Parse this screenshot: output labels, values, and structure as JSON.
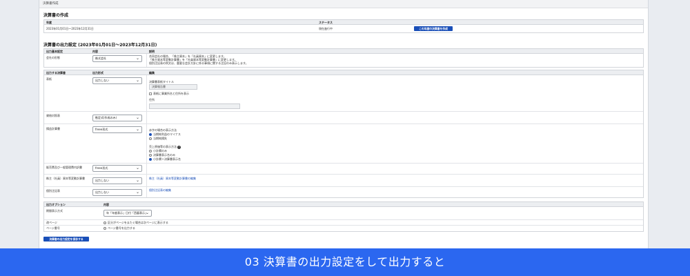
{
  "page_tab": "決算書作成",
  "create": {
    "heading": "決算書の作成",
    "col_period": "年度",
    "col_status": "ステータス",
    "period_value": "2023年01月01日〜2023年12月31日",
    "status_value": "現在進行中",
    "create_button": "この年度の決算書を作成"
  },
  "output": {
    "heading": "決算書の出力設定 (2023年01月01日〜2023年12月31日)",
    "basic": {
      "col_setting": "出力基本設定",
      "col_content": "内容",
      "col_desc": "説明",
      "row_label": "会社の形態",
      "row_value": "株式会社",
      "desc_1": "合同会社の場合、「株主資本」を「社員資本」に変更します。",
      "desc_2": "「株主資本等変動計算書」を「社員資本等変動計算書」に変更します。",
      "desc_3": "個別注記表の例文は、重要な会計方針に係る事項に関する注記のみ表示します。"
    },
    "statements": {
      "col_statement": "出力する決算書",
      "col_format": "出力形式",
      "col_edit": "編集",
      "cover": {
        "label": "表紙",
        "value": "出力しない",
        "title_label": "決算書表紙タイトル",
        "title_value": "決算報告書",
        "checkbox_label": "表紙に事業所名と住所を表示",
        "address_label": "住所",
        "address_value": ""
      },
      "balance": {
        "label": "貸借対照表",
        "value": "勘定式(作成のみ)"
      },
      "pl": {
        "label": "損益計算書",
        "value": "freee形式",
        "group1_label": "赤字の場合の表示方法",
        "g1_opt1": "当期純利益のマイナス",
        "g1_opt2": "当期純損失",
        "group2_label": "売上原価等の表示方法",
        "g2_opt1": "小計欄のみ",
        "g2_opt2": "決算書表示名のみ",
        "g2_opt3": "小計欄＋決算書表示名"
      },
      "mfg": {
        "label": "販売費及び一般管理費内訳書",
        "value": "freee形式"
      },
      "equity": {
        "label": "株主（社員）資本等変動計算書",
        "value": "出力しない",
        "link": "株主（社員）資本等変動計算書の編集"
      },
      "notes": {
        "label": "個別注記表",
        "value": "出力しない",
        "link": "個別注記表の編集"
      }
    },
    "options": {
      "col_option": "出力オプション",
      "col_content": "内容",
      "date_label": "期間表示方式",
      "date_value": "年「年度表示」日付「西暦表示」",
      "page_label": "改ページ",
      "page_option": "区分がページをまたぐ場合は次ページに表示する",
      "num_label": "ページ番号",
      "num_option": "ページ番号を出力する"
    },
    "save_button": "決算書の出力設定を保存する"
  },
  "banner": "03 決算書の出力設定をして出力すると",
  "colors": {
    "accent": "#2b67f0",
    "button": "#1a4fb8"
  }
}
